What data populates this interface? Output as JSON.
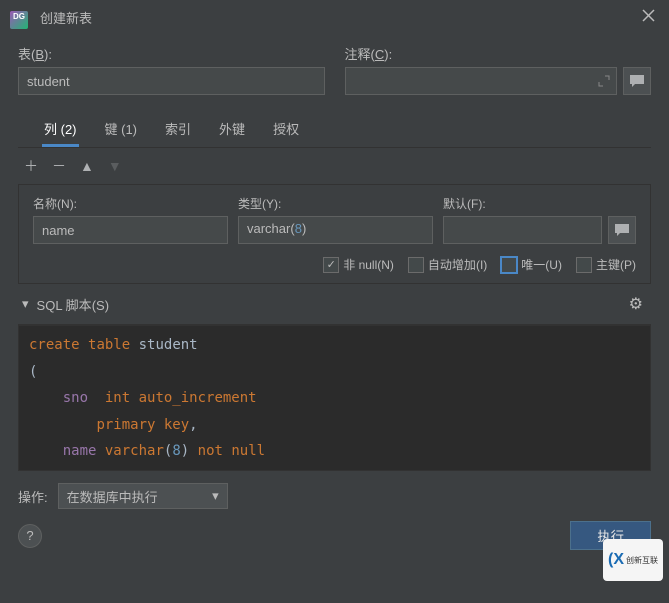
{
  "dialog_title": "创建新表",
  "labels": {
    "table": "表",
    "table_key": "B",
    "comment": "注释",
    "comment_key": "C"
  },
  "table_name": "student",
  "tabs": [
    {
      "label": "列 (2)",
      "active": true
    },
    {
      "label": "键 (1)",
      "active": false
    },
    {
      "label": "索引",
      "active": false
    },
    {
      "label": "外键",
      "active": false
    },
    {
      "label": "授权",
      "active": false
    }
  ],
  "column_form": {
    "name_label": "名称",
    "name_key": "N",
    "name_value": "name",
    "type_label": "类型",
    "type_key": "Y",
    "type_base": "varchar",
    "type_arg": "8",
    "default_label": "默认",
    "default_key": "F",
    "default_value": ""
  },
  "checks": {
    "not_null": {
      "label": "非 null",
      "key": "N",
      "checked": true
    },
    "auto_inc": {
      "label": "自动增加",
      "key": "I",
      "checked": false
    },
    "unique": {
      "label": "唯一",
      "key": "U",
      "checked": false,
      "highlight": true
    },
    "primary": {
      "label": "主键",
      "key": "P",
      "checked": false
    }
  },
  "sql_section_label": "SQL 脚本",
  "sql_section_key": "S",
  "sql": {
    "l1_kw1": "create",
    "l1_kw2": "table",
    "l1_id": "student",
    "l2": "(",
    "l3_col": "sno",
    "l3_type": "int auto_increment",
    "l4": "primary key",
    "l5_col": "name",
    "l5_type": "varchar",
    "l5_arg": "8",
    "l5_nn": "not null"
  },
  "action_label": "操作:",
  "action_value": "在数据库中执行",
  "execute_button": "执行",
  "watermark": "创新互联"
}
